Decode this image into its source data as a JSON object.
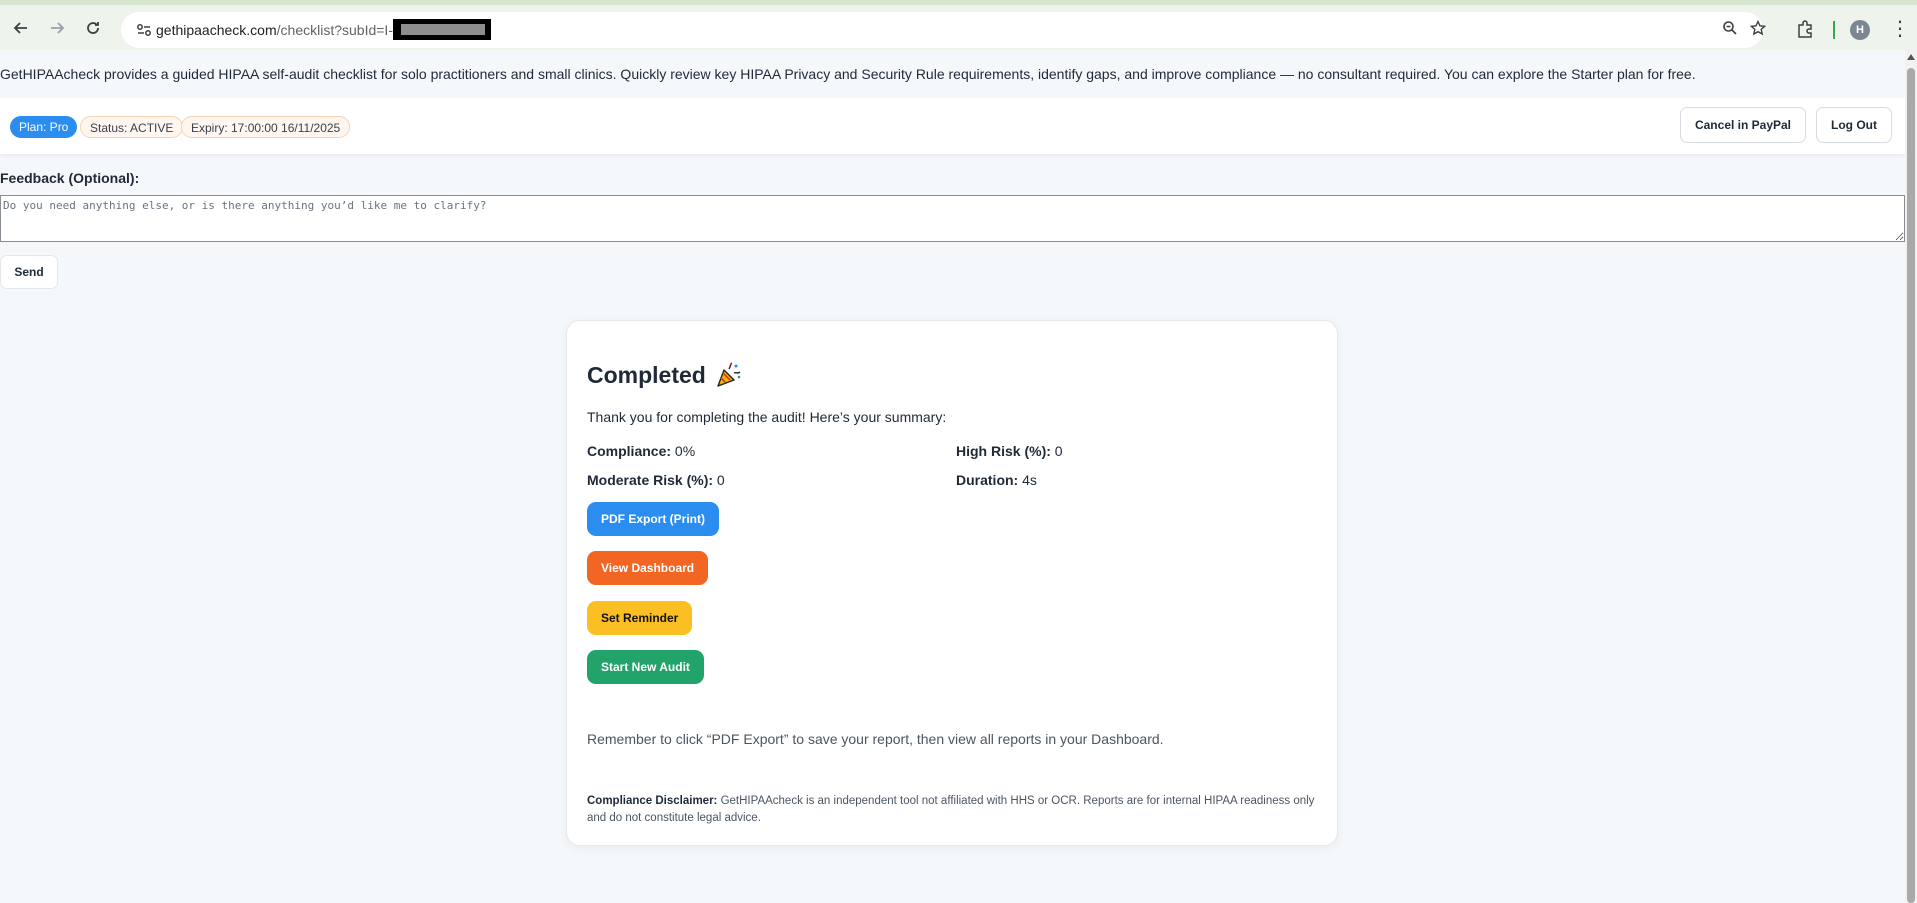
{
  "browser": {
    "url_host": "gethipaacheck.com",
    "url_path": "/checklist?subId=I-",
    "avatar_initial": "H"
  },
  "intro_text": "GetHIPAAcheck provides a guided HIPAA self-audit checklist for solo practitioners and small clinics. Quickly review key HIPAA Privacy and Security Rule requirements, identify gaps, and improve compliance — no consultant required. You can explore the Starter plan for free.",
  "plan_bar": {
    "plan": "Plan: Pro",
    "status": "Status: ACTIVE",
    "expiry": "Expiry: 17:00:00 16/11/2025",
    "cancel_label": "Cancel in PayPal",
    "logout_label": "Log Out"
  },
  "feedback": {
    "label": "Feedback (Optional):",
    "placeholder": "Do you need anything else, or is there anything you’d like me to clarify?",
    "send_label": "Send"
  },
  "summary": {
    "title": "Completed",
    "subtitle": "Thank you for completing the audit! Here’s your summary:",
    "compliance_label": "Compliance:",
    "compliance_value": "0%",
    "high_risk_label": "High Risk (%):",
    "high_risk_value": "0",
    "moderate_risk_label": "Moderate Risk (%):",
    "moderate_risk_value": "0",
    "duration_label": "Duration:",
    "duration_value": "4s",
    "buttons": {
      "pdf_export": "PDF Export (Print)",
      "view_dashboard": "View Dashboard",
      "set_reminder": "Set Reminder",
      "start_new_audit": "Start New Audit"
    },
    "remember_text": "Remember to click “PDF Export” to save your report, then view all reports in your Dashboard.",
    "disclaimer_label": "Compliance Disclaimer:",
    "disclaimer_text": "GetHIPAAcheck is an independent tool not affiliated with HHS or OCR. Reports are for internal HIPAA readiness only and do not constitute legal advice."
  },
  "colors": {
    "pdf_export": "#2b8df0",
    "view_dashboard": "#f26522",
    "set_reminder": "#fbbf24",
    "start_new_audit": "#22a36a"
  }
}
